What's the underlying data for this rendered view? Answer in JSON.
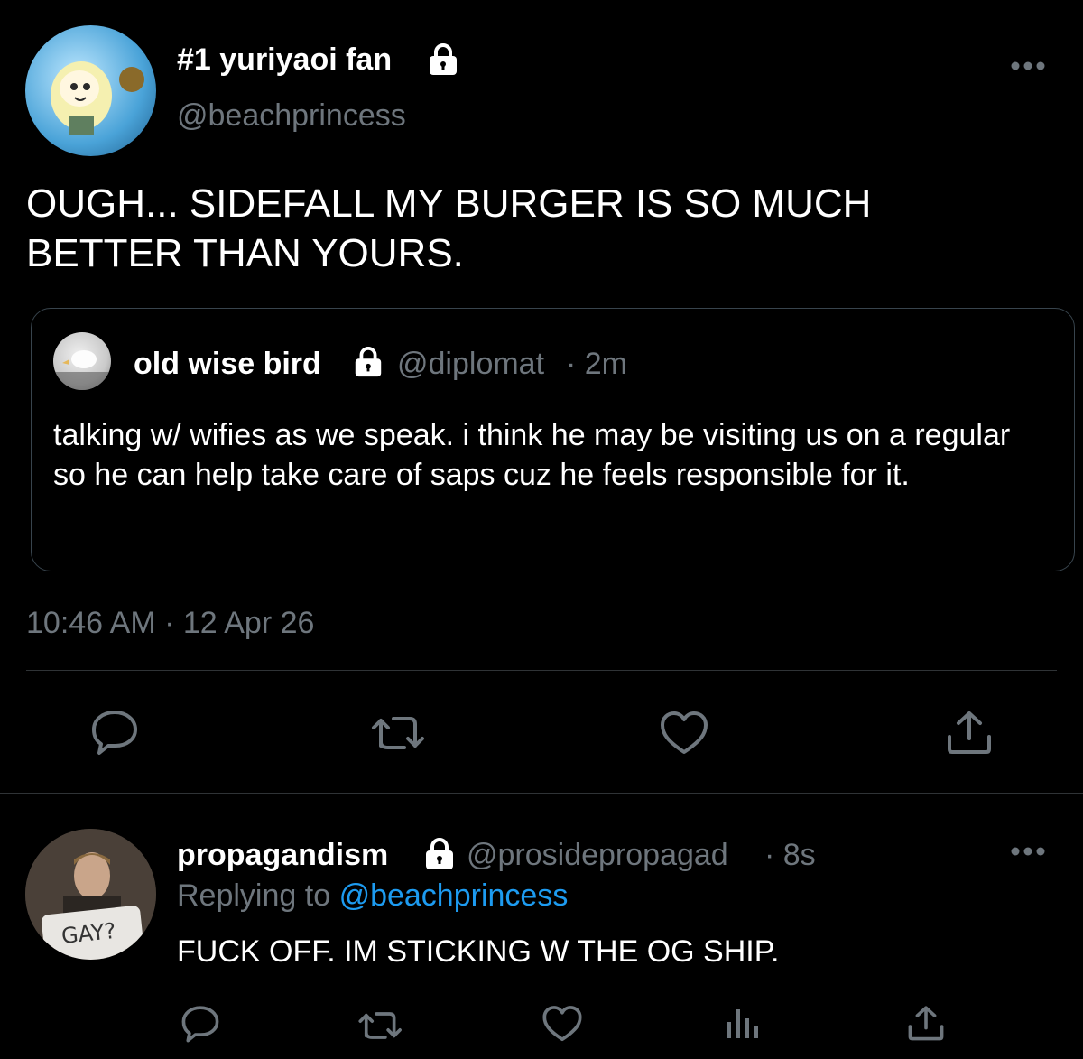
{
  "tweet": {
    "display_name": "#1 yuriyaoi fan",
    "handle": "@beachprincess",
    "text": "OUGH... SIDEFALL MY BURGER IS SO MUCH BETTER THAN YOURS.",
    "timestamp": "10:46 AM · 12 Apr 26",
    "locked": true
  },
  "quoted": {
    "display_name": "old wise bird",
    "handle": "@diplomat",
    "age": "· 2m",
    "text": "talking w/ wifies as we speak. i think he may be visiting us on a regular so he can help take care of saps cuz he feels responsible for it.",
    "locked": true
  },
  "reply": {
    "display_name": "propagandism",
    "handle": "@prosidepropagad",
    "age": "· 8s",
    "replying_prefix": "Replying to",
    "replying_to": "@beachprincess",
    "text": "FUCK OFF. IM STICKING W THE OG SHIP.",
    "avatar_sign": "GAY?",
    "locked": true
  },
  "actions": {
    "main": [
      "reply-icon",
      "retweet-icon",
      "like-icon",
      "share-icon"
    ],
    "reply": [
      "reply-icon",
      "retweet-icon",
      "like-icon",
      "analytics-icon",
      "share-icon"
    ]
  },
  "colors": {
    "background": "#000000",
    "muted": "#6e767d",
    "link": "#1d9bf0",
    "border": "#2f3336"
  }
}
